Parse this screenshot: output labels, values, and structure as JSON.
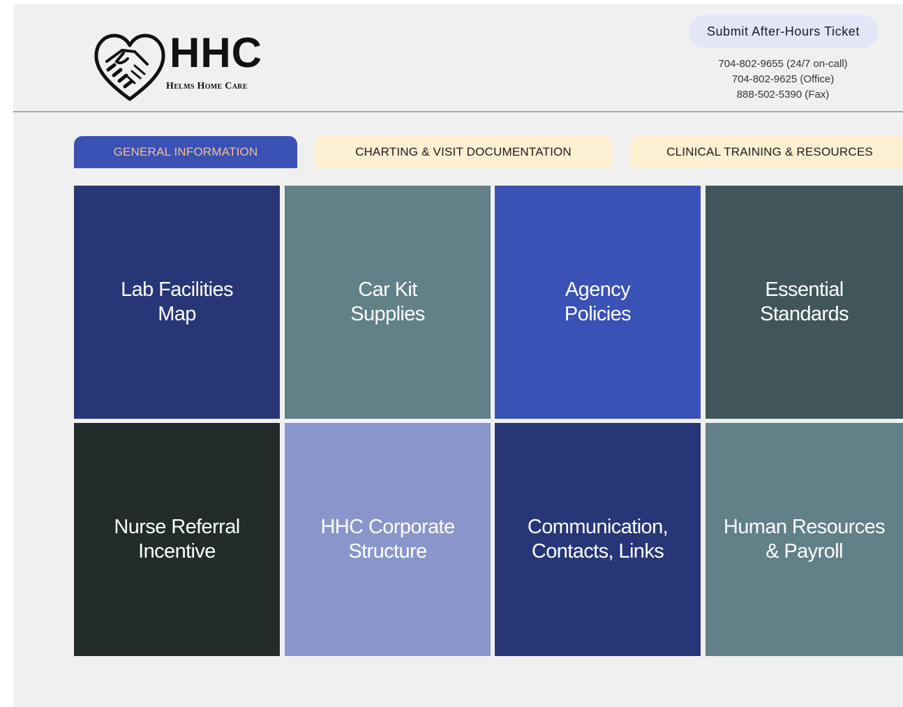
{
  "brand": {
    "name": "HHC",
    "subtitle": "Helms Home Care"
  },
  "header": {
    "ticket_button": "Submit After-Hours Ticket",
    "phones": [
      "704-802-9655 (24/7 on-call)",
      "704-802-9625 (Office)",
      "888-502-5390 (Fax)"
    ]
  },
  "tabs": [
    {
      "label": "GENERAL INFORMATION",
      "active": true
    },
    {
      "label": "CHARTING & VISIT DOCUMENTATION",
      "active": false
    },
    {
      "label": "CLINICAL TRAINING & RESOURCES",
      "active": false
    }
  ],
  "tiles": [
    {
      "label": "Lab Facilities\nMap",
      "color": "#273677"
    },
    {
      "label": "Car Kit\nSupplies",
      "color": "#618087"
    },
    {
      "label": "Agency\nPolicies",
      "color": "#3a51b5"
    },
    {
      "label": "Essential\nStandards",
      "color": "#41565a"
    },
    {
      "label": "Nurse Referral\nIncentive",
      "color": "#232b2b"
    },
    {
      "label": "HHC Corporate\nStructure",
      "color": "#8896cb"
    },
    {
      "label": "Communication,\nContacts, Links",
      "color": "#273677"
    },
    {
      "label": "Human Resources\n& Payroll",
      "color": "#618087"
    }
  ]
}
